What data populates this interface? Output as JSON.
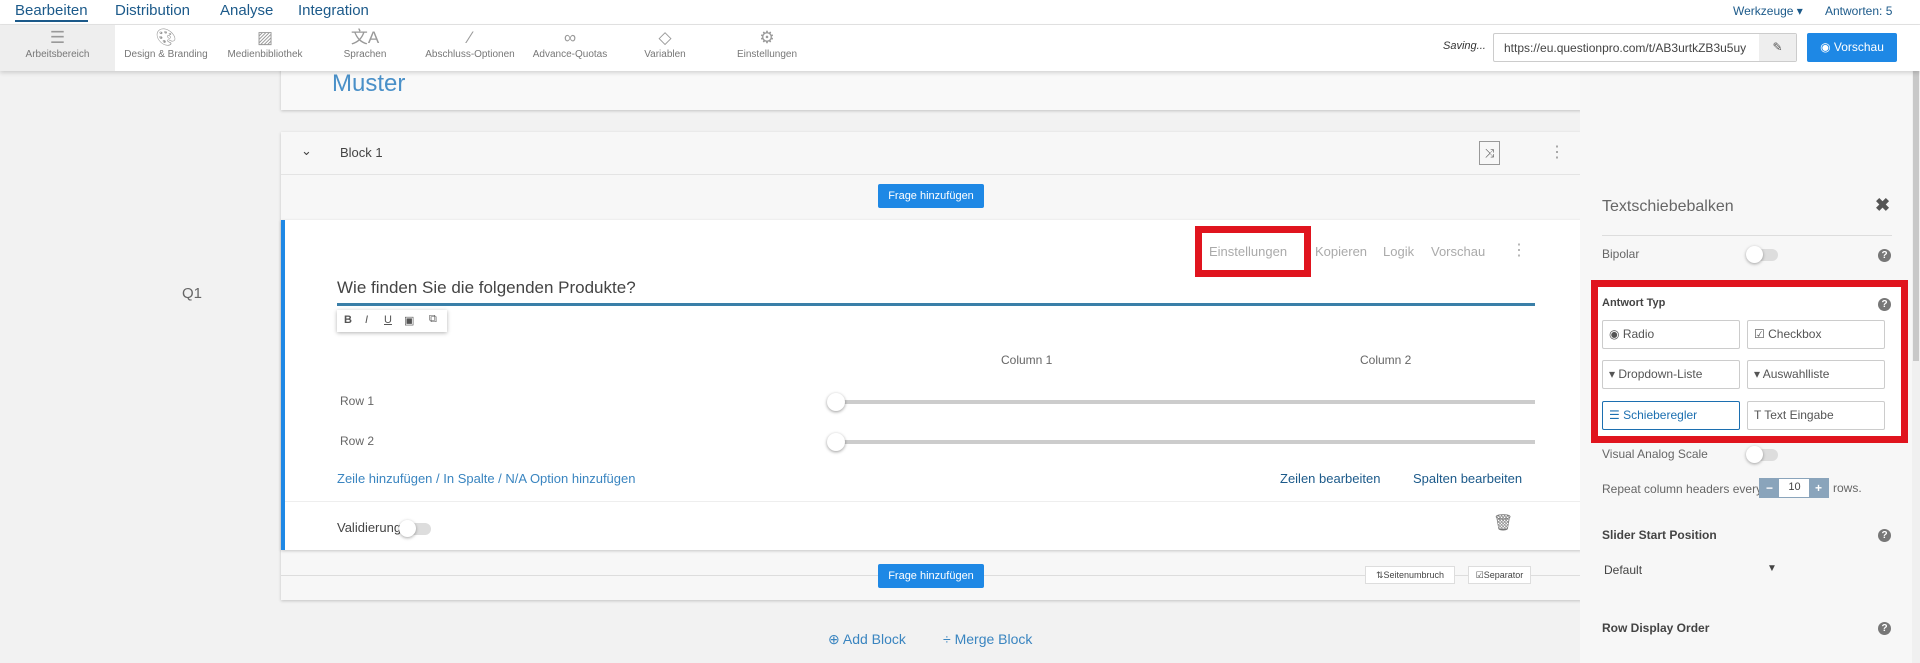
{
  "topnav": {
    "tabs": [
      "Bearbeiten",
      "Distribution",
      "Analyse",
      "Integration"
    ],
    "tools_menu": "Werkzeuge ▾",
    "responses": "Antworten: 5"
  },
  "toolbar": {
    "items": [
      {
        "label": "Arbeitsbereich",
        "icon": "workspace-icon"
      },
      {
        "label": "Design & Branding",
        "icon": "palette-icon"
      },
      {
        "label": "Medienbibliothek",
        "icon": "image-icon"
      },
      {
        "label": "Sprachen",
        "icon": "language-icon"
      },
      {
        "label": "Abschluss-Optionen",
        "icon": "magic-wand-icon"
      },
      {
        "label": "Advance-Quotas",
        "icon": "link-icon"
      },
      {
        "label": "Variablen",
        "icon": "tag-icon"
      },
      {
        "label": "Einstellungen",
        "icon": "gear-icon"
      }
    ],
    "saving": "Saving...",
    "url": "https://eu.questionpro.com/t/AB3urtkZB3u5uy",
    "preview": "Vorschau"
  },
  "survey": {
    "title": "Muster",
    "block_title": "Block 1",
    "add_question": "Frage hinzufügen",
    "question": {
      "number": "Q1",
      "text": "Wie finden Sie die folgenden Produkte?",
      "actions": [
        "Einstellungen",
        "Kopieren",
        "Logik",
        "Vorschau"
      ],
      "format": [
        "B",
        "I",
        "U"
      ],
      "columns": [
        "Column 1",
        "Column 2"
      ],
      "rows": [
        {
          "label": "Row 1",
          "value": 0
        },
        {
          "label": "Row 2",
          "value": 0
        }
      ],
      "add_link": "Zeile hinzufügen / In Spalte / N/A Option hinzufügen",
      "edit_rows": "Zeilen bearbeiten",
      "edit_cols": "Spalten bearbeiten",
      "validation": "Validierung"
    },
    "page_break": "Seitenumbruch",
    "separator": "Separator",
    "add_block": "Add Block",
    "merge_block": "Merge Block"
  },
  "panel": {
    "title": "Textschiebebalken",
    "bipolar": "Bipolar",
    "answer_type": "Antwort Typ",
    "types": [
      {
        "label": "Radio",
        "icon": "◉"
      },
      {
        "label": "Checkbox",
        "icon": "☑"
      },
      {
        "label": "Dropdown-Liste",
        "icon": "▾"
      },
      {
        "label": "Auswahlliste",
        "icon": "▾"
      },
      {
        "label": "Schieberegler",
        "icon": "☰"
      },
      {
        "label": "Text Eingabe",
        "icon": "T"
      }
    ],
    "selected_type": "Schieberegler",
    "vas": "Visual Analog Scale",
    "repeat_prefix": "Repeat column headers every",
    "repeat_value": "10",
    "repeat_suffix": "rows.",
    "slider_start": "Slider Start Position",
    "slider_start_value": "Default",
    "row_order": "Row Display Order"
  },
  "colors": {
    "accent": "#1e88e5",
    "highlight": "#e0141e",
    "nav": "#1c5a8a"
  }
}
